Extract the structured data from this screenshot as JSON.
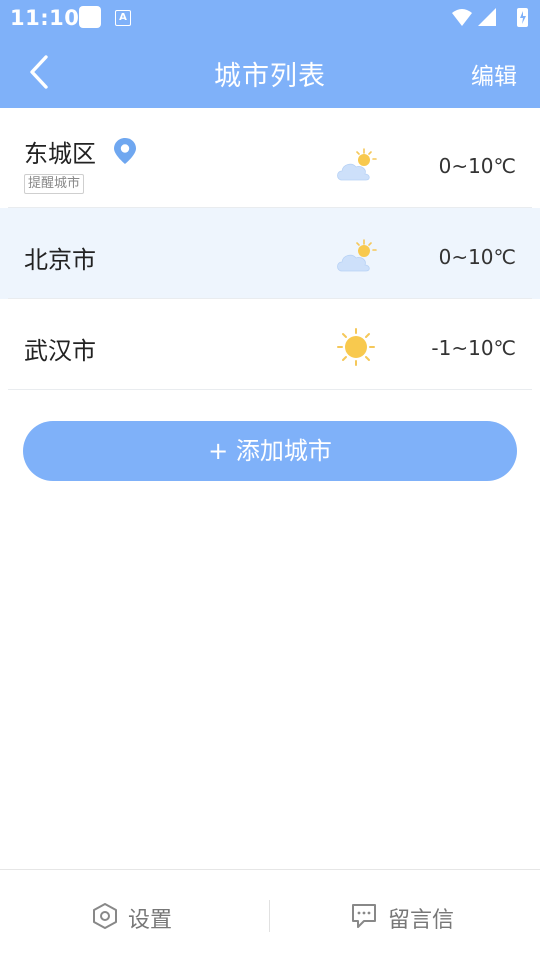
{
  "status_bar": {
    "time": "11:10",
    "keyboard_indicator": "A"
  },
  "header": {
    "title": "城市列表",
    "edit_label": "编辑"
  },
  "cities": [
    {
      "name": "东城区",
      "tag": "提醒城市",
      "icon": "partly-cloudy-icon",
      "temp": "0~10℃",
      "located": true
    },
    {
      "name": "北京市",
      "icon": "partly-cloudy-icon",
      "temp": "0~10℃"
    },
    {
      "name": "武汉市",
      "icon": "sunny-icon",
      "temp": "-1~10℃"
    }
  ],
  "add_button": {
    "label": "+ 添加城市"
  },
  "bottom_nav": {
    "settings_label": "设置",
    "messages_label": "留言信"
  },
  "colors": {
    "accent": "#7fb1f9",
    "highlight_row": "#eef5fd"
  }
}
